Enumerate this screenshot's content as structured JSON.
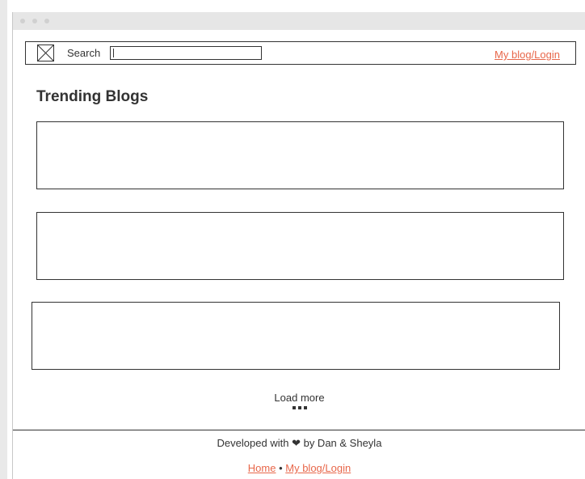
{
  "header": {
    "search_label": "Search",
    "search_value": "",
    "login_link": "My blog/Login"
  },
  "main": {
    "heading": "Trending Blogs",
    "cards": [
      "",
      "",
      ""
    ],
    "load_more": "Load more"
  },
  "footer": {
    "credit_prefix": "Developed with",
    "heart": "❤",
    "credit_suffix": "by Dan & Sheyla",
    "home_link": "Home",
    "separator": "•",
    "login_link": "My blog/Login"
  },
  "colors": {
    "accent": "#e8674a",
    "text": "#333333",
    "titlebar": "#e6e6e6"
  },
  "icons": {
    "logo": "image-placeholder-icon",
    "heart": "heart-icon",
    "loading": "dots-icon"
  }
}
